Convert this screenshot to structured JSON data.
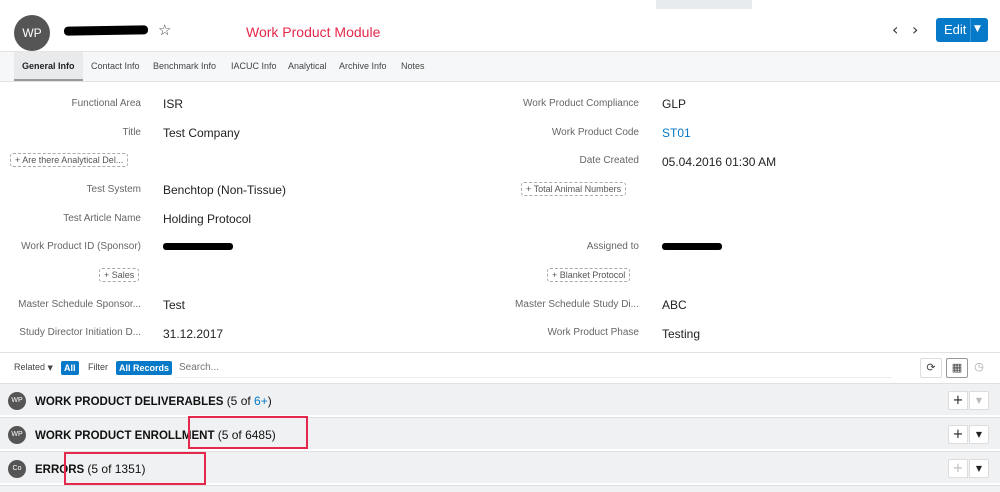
{
  "header": {
    "avatar": "WP",
    "module_label": "Work Product Module",
    "edit_label": "Edit"
  },
  "tabs": [
    {
      "label": "General Info"
    },
    {
      "label": "Contact Info"
    },
    {
      "label": "Benchmark Info"
    },
    {
      "label": "IACUC Info"
    },
    {
      "label": "Analytical"
    },
    {
      "label": "Archive Info"
    },
    {
      "label": "Notes"
    }
  ],
  "fields": {
    "functional_area": {
      "label": "Functional Area",
      "value": "ISR"
    },
    "title": {
      "label": "Title",
      "value": "Test Company"
    },
    "analytical_del": {
      "label": "Are there Analytical Del..."
    },
    "test_system": {
      "label": "Test System",
      "value": "Benchtop (Non-Tissue)"
    },
    "test_article_name": {
      "label": "Test Article Name",
      "value": "Holding Protocol"
    },
    "wp_id_sponsor": {
      "label": "Work Product ID (Sponsor)"
    },
    "sales": {
      "label": "Sales"
    },
    "master_schedule_sponsor": {
      "label": "Master Schedule Sponsor...",
      "value": "Test"
    },
    "sd_initiation": {
      "label": "Study Director Initiation D...",
      "value": "31.12.2017"
    },
    "wp_compliance": {
      "label": "Work Product Compliance",
      "value": "GLP"
    },
    "wp_code": {
      "label": "Work Product Code",
      "value": "ST01"
    },
    "date_created": {
      "label": "Date Created",
      "value": "05.04.2016 01:30 AM"
    },
    "total_animal_numbers": {
      "label": "Total Animal Numbers"
    },
    "assigned_to": {
      "label": "Assigned to"
    },
    "blanket_protocol": {
      "label": "Blanket Protocol"
    },
    "master_schedule_sd": {
      "label": "Master Schedule Study Di...",
      "value": "ABC"
    },
    "wp_phase": {
      "label": "Work Product Phase",
      "value": "Testing"
    }
  },
  "filterbar": {
    "related_label": "Related",
    "related_value": "All",
    "filter_label": "Filter",
    "filter_value": "All Records",
    "search_placeholder": "Search..."
  },
  "subpanels": [
    {
      "avatar": "WP",
      "title": "WORK PRODUCT DELIVERABLES",
      "count_open": "(5 of ",
      "count_link": "6+",
      "count_close": ")"
    },
    {
      "avatar": "WP",
      "title": "WORK PRODUCT ENROLLMENT",
      "count": "(5 of 6485)"
    },
    {
      "avatar": "Co",
      "title": "ERRORS",
      "count": "(5 of 1351)"
    }
  ],
  "colors": {
    "accent": "#0679c8",
    "highlight_red": "#e4294c"
  }
}
